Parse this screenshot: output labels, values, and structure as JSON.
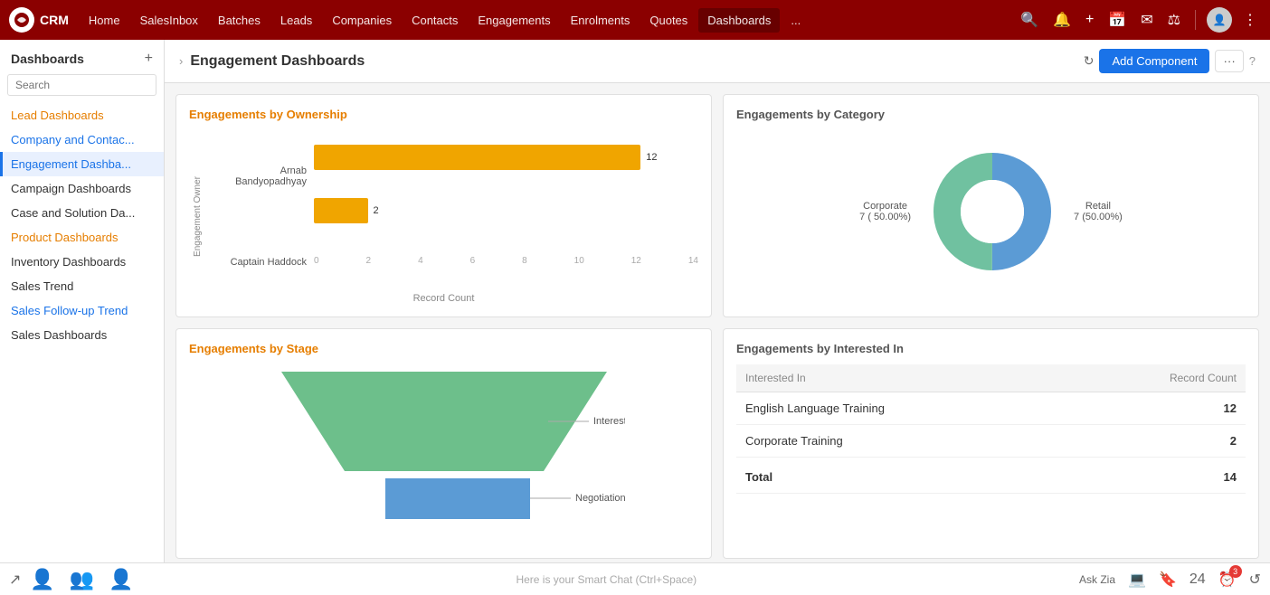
{
  "topnav": {
    "logo_text": "CRM",
    "items": [
      {
        "label": "Home",
        "active": false
      },
      {
        "label": "SalesInbox",
        "active": false
      },
      {
        "label": "Batches",
        "active": false
      },
      {
        "label": "Leads",
        "active": false
      },
      {
        "label": "Companies",
        "active": false
      },
      {
        "label": "Contacts",
        "active": false
      },
      {
        "label": "Engagements",
        "active": false
      },
      {
        "label": "Enrolments",
        "active": false
      },
      {
        "label": "Quotes",
        "active": false
      },
      {
        "label": "Dashboards",
        "active": true
      },
      {
        "label": "...",
        "active": false
      }
    ]
  },
  "sidebar": {
    "title": "Dashboards",
    "search_placeholder": "Search",
    "items": [
      {
        "label": "Lead Dashboards",
        "type": "orange",
        "active": false
      },
      {
        "label": "Company and Contac...",
        "type": "blue-link",
        "active": false
      },
      {
        "label": "Engagement Dashba...",
        "type": "active",
        "active": true
      },
      {
        "label": "Campaign Dashboards",
        "type": "normal",
        "active": false
      },
      {
        "label": "Case and Solution Da...",
        "type": "normal",
        "active": false
      },
      {
        "label": "Product Dashboards",
        "type": "orange",
        "active": false
      },
      {
        "label": "Inventory Dashboards",
        "type": "normal",
        "active": false
      },
      {
        "label": "Sales Trend",
        "type": "normal",
        "active": false
      },
      {
        "label": "Sales Follow-up Trend",
        "type": "blue-link",
        "active": false
      },
      {
        "label": "Sales Dashboards",
        "type": "normal",
        "active": false
      }
    ]
  },
  "header": {
    "breadcrumb_arrow": "›",
    "title": "Engagement Dashboards",
    "add_component_label": "Add Component",
    "more_label": "···"
  },
  "charts": {
    "ownership": {
      "title": "Engagements by Ownership",
      "y_axis_label": "Engagement Owner",
      "x_axis_label": "Record Count",
      "bars": [
        {
          "label": "Arnab Bandyopadhyay",
          "value": 12,
          "width_pct": 85
        },
        {
          "label": "Captain Haddock",
          "value": 2,
          "width_pct": 14
        }
      ],
      "x_ticks": [
        "0",
        "2",
        "4",
        "6",
        "8",
        "10",
        "12",
        "14"
      ]
    },
    "category": {
      "title": "Engagements by Category",
      "segments": [
        {
          "label": "Corporate",
          "sub": "7 ( 50.00%)",
          "value": 7,
          "color": "#5b9bd5",
          "percent": 50
        },
        {
          "label": "Retail",
          "sub": "7 (50.00%)",
          "value": 7,
          "color": "#70c1a0",
          "percent": 50
        }
      ]
    },
    "stage": {
      "title": "Engagements by Stage",
      "funnel": [
        {
          "label": "Interested",
          "color": "#6dbf8b",
          "width_pct": 85
        },
        {
          "label": "Negotiation",
          "color": "#5b9bd5",
          "width_pct": 40
        }
      ]
    },
    "interested_in": {
      "title": "Engagements by Interested In",
      "col_interested": "Interested In",
      "col_count": "Record Count",
      "rows": [
        {
          "label": "English Language Training",
          "count": 12
        },
        {
          "label": "Corporate Training",
          "count": 2
        }
      ],
      "total_label": "Total",
      "total_count": 14
    }
  },
  "bottom": {
    "chat_placeholder": "Here is your Smart Chat (Ctrl+Space)",
    "ask_zia": "Ask Zia",
    "badge_count": "3"
  }
}
